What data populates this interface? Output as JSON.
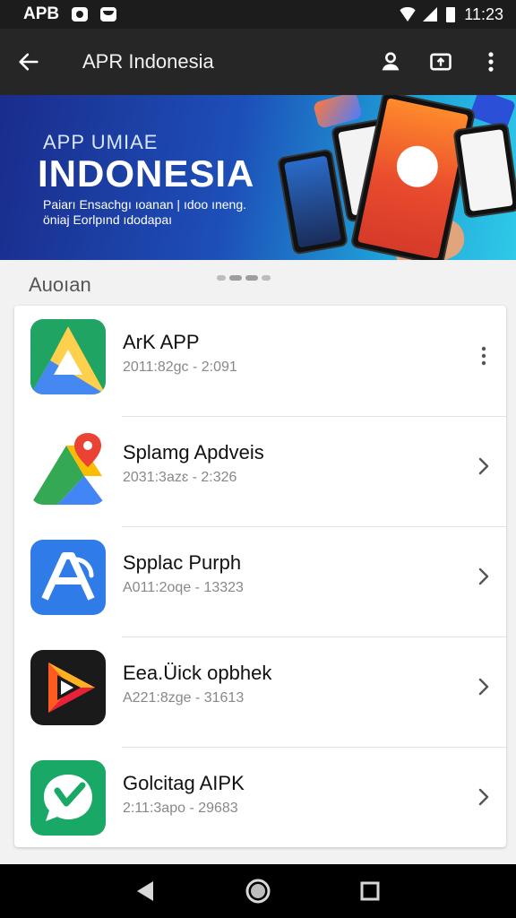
{
  "status_bar": {
    "app_label": "APB",
    "time": "11:23"
  },
  "app_bar": {
    "title": "APR Indonesia",
    "icons": [
      "back-arrow-icon",
      "account-icon",
      "cast-icon",
      "more-vert-icon"
    ]
  },
  "banner": {
    "kicker": "APP UMIAE",
    "title": "INDONESIA",
    "description": "Paiarı Ensachgı ıoanan | ıdoo ıneng. öniaj Eorlpınd ıdodapaı"
  },
  "section": {
    "label": "Auoıan"
  },
  "carousel": {
    "count": 4,
    "active_index": 2
  },
  "apps": [
    {
      "name": "ArK APP",
      "meta": "2011:82gc - 2:091",
      "icon": "drive-triangle-icon",
      "action": "more-vert-icon"
    },
    {
      "name": "Splamg Apdveis",
      "meta": "2031:3azɛ - 2:326",
      "icon": "maps-pin-icon",
      "action": "chevron-right-icon"
    },
    {
      "name": "Spplac Purph",
      "meta": "A011:2oqe - 13323",
      "icon": "letter-a-icon",
      "action": "chevron-right-icon"
    },
    {
      "name": "Eea.Üick opbhek",
      "meta": "A221:8zge - 31613",
      "icon": "play-triangle-icon",
      "action": "chevron-right-icon"
    },
    {
      "name": "Golcitag AIPK",
      "meta": "2:11:3apo - 29683",
      "icon": "check-bubble-icon",
      "action": "chevron-right-icon"
    }
  ],
  "colors": {
    "status_bar": "#1c1c1c",
    "app_bar": "#262626",
    "banner_start": "#1a2c8c",
    "banner_end": "#2fc9e8",
    "background": "#f2f2f2"
  }
}
